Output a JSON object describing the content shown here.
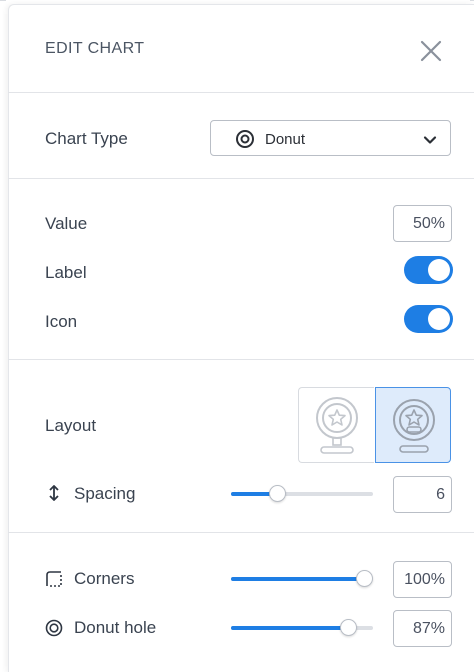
{
  "panel": {
    "title": "EDIT CHART",
    "close_icon": "close-icon"
  },
  "chart_type": {
    "label": "Chart Type",
    "selected": "Donut",
    "icon": "donut-icon",
    "dropdown_icon": "chevron-down-icon"
  },
  "value": {
    "label": "Value",
    "input": "50%"
  },
  "label_toggle": {
    "label": "Label",
    "on": true
  },
  "icon_toggle": {
    "label": "Icon",
    "on": true
  },
  "layout": {
    "label": "Layout",
    "options": [
      {
        "icon": "donut-star-layout-icon",
        "selected": false
      },
      {
        "icon": "donut-star-layout-icon",
        "selected": true
      }
    ]
  },
  "spacing": {
    "label": "Spacing",
    "icon": "vertical-resize-icon",
    "input": "6",
    "slider_fraction": 0.3
  },
  "corners": {
    "label": "Corners",
    "icon": "dashed-corner-icon",
    "input": "100%",
    "slider_fraction": 1.0
  },
  "donut_hole": {
    "label": "Donut hole",
    "icon": "donut-hole-icon",
    "input": "87%",
    "slider_fraction": 0.87
  },
  "colors": {
    "accent": "#1e7ee4",
    "selected_bg": "#deebfb"
  }
}
